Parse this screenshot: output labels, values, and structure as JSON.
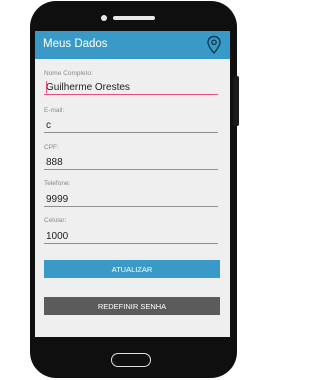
{
  "header": {
    "title": "Meus Dados",
    "icon": "location-pin-icon"
  },
  "form": {
    "fields": [
      {
        "label": "Nome Completo:",
        "value": "Guilherme Orestes",
        "focused": true
      },
      {
        "label": "E-mail:",
        "value": "c"
      },
      {
        "label": "CPF:",
        "value": "888"
      },
      {
        "label": "Telefone:",
        "value": "9999"
      },
      {
        "label": "Celular:",
        "value": "1000"
      }
    ]
  },
  "buttons": {
    "update_label": "ATUALIZAR",
    "reset_password_label": "REDEFINIR SENHA"
  },
  "colors": {
    "accent": "#3a9ac7",
    "focus": "#e34f7e",
    "secondary_button": "#5b5b5b"
  }
}
